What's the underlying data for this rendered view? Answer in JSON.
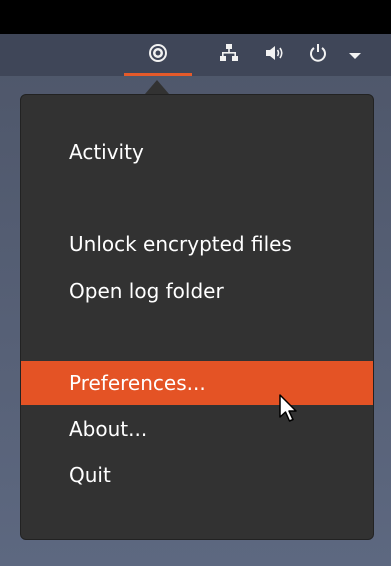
{
  "panel": {
    "indicators": [
      {
        "icon": "app-indicator-icon"
      },
      {
        "icon": "network-icon"
      },
      {
        "icon": "volume-icon"
      },
      {
        "icon": "power-icon"
      },
      {
        "icon": "chevron-down-icon"
      }
    ],
    "accent": "#e55a2a"
  },
  "menu": {
    "items": [
      {
        "label": "Activity"
      },
      {
        "label": "Unlock encrypted files"
      },
      {
        "label": "Open log folder"
      },
      {
        "label": "Preferences..."
      },
      {
        "label": "About..."
      },
      {
        "label": "Quit"
      }
    ],
    "active_item": "Preferences...",
    "highlight_color": "#e45325",
    "background_color": "#323232"
  }
}
